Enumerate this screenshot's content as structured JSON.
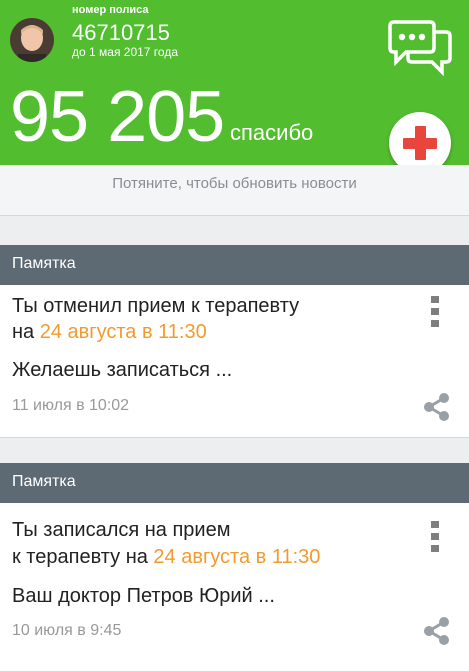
{
  "header": {
    "policy_label": "номер полиса",
    "policy_number": "46710715",
    "valid_until": "до 1 мая 2017 года",
    "score": "95 205",
    "score_unit": "спасибо"
  },
  "pull_hint": "Потяните, чтобы обновить новости",
  "cards": [
    {
      "section": "Памятка",
      "line1": "Ты отменил прием к терапевту",
      "line2_prefix": "на ",
      "line2_accent": "24 августа в 11:30",
      "line3": "Желаешь записаться ...",
      "date": "11 июля в 10:02"
    },
    {
      "section": "Памятка",
      "line1": "Ты записался на прием",
      "line2_prefix": "к терапевту на ",
      "line2_accent": "24 августа в 11:30",
      "line3": "Ваш доктор Петров Юрий ...",
      "date": "10 июля в 9:45"
    }
  ],
  "colors": {
    "green": "#52be2f",
    "accent": "#f39a2e",
    "section": "#5e6a73",
    "plus": "#e8453c"
  },
  "icons": [
    "chat-icon",
    "plus-icon",
    "more-icon",
    "share-icon"
  ]
}
